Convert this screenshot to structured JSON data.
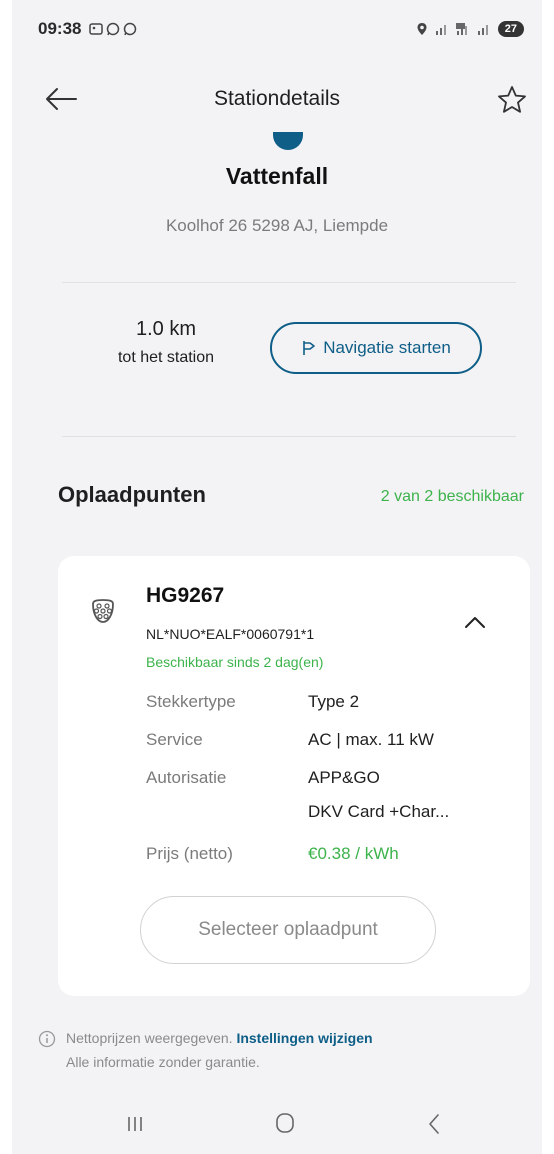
{
  "status_bar": {
    "time": "09:38",
    "left_icons": [
      "gallery-icon",
      "whatsapp-icon",
      "whatsapp-icon"
    ],
    "battery": "27"
  },
  "header": {
    "title": "Stationdetails",
    "back_icon": "arrow-left-icon",
    "favorite_icon": "star-outline-icon"
  },
  "station": {
    "operator": "Vattenfall",
    "address": "Koolhof 26 5298 AJ, Liempde",
    "distance_value": "1.0 km",
    "distance_label": "tot het station",
    "navigate_label": "Navigatie starten"
  },
  "charge_points": {
    "title": "Oplaadpunten",
    "availability": "2 van 2 beschikbaar",
    "items": [
      {
        "id": "HG9267",
        "evse_id": "NL*NUO*EALF*0060791*1",
        "status": "Beschikbaar sinds 2 dag(en)",
        "details": [
          {
            "label": "Stekkertype",
            "value": "Type 2"
          },
          {
            "label": "Service",
            "value": "AC | max. 11 kW"
          },
          {
            "label": "Autorisatie",
            "value": "APP&GO",
            "value2": "DKV Card +Char..."
          },
          {
            "label": "Prijs (netto)",
            "value": "€0.38 / kWh"
          }
        ],
        "select_label": "Selecteer oplaadpunt"
      }
    ]
  },
  "footer": {
    "note_prefix": "Nettoprijzen weergegeven. ",
    "note_link": "Instellingen wijzigen",
    "note_line2": "Alle informatie zonder garantie."
  },
  "colors": {
    "accent": "#0e5e88",
    "available_green": "#3db34c",
    "background": "#f3f3f5"
  }
}
